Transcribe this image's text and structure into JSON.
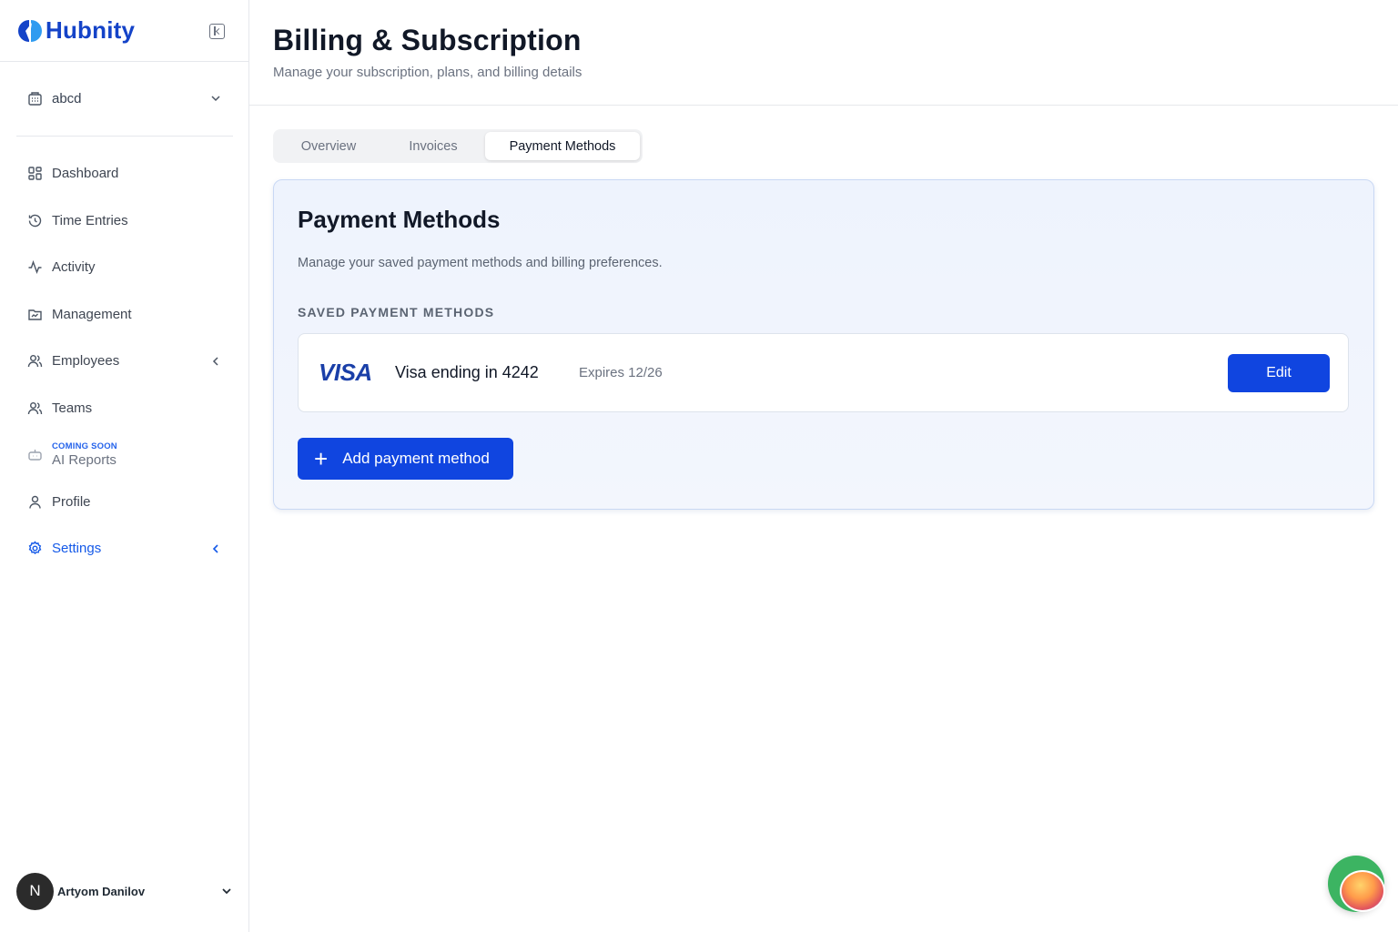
{
  "app": {
    "name": "Hubnity"
  },
  "workspace": {
    "name": "abcd"
  },
  "nav": [
    {
      "label": "Dashboard",
      "icon": "dashboard-icon"
    },
    {
      "label": "Time Entries",
      "icon": "history-icon"
    },
    {
      "label": "Activity",
      "icon": "activity-icon"
    },
    {
      "label": "Management",
      "icon": "folder-icon"
    },
    {
      "label": "Employees",
      "icon": "users-icon"
    },
    {
      "label": "Teams",
      "icon": "users-icon"
    },
    {
      "label": "AI Reports",
      "badge": "COMING SOON",
      "icon": "bot-icon"
    },
    {
      "label": "Profile",
      "icon": "user-icon"
    },
    {
      "label": "Settings",
      "icon": "gear-icon",
      "active": true
    }
  ],
  "user": {
    "initial": "N",
    "name": "Artyom Danilov"
  },
  "page": {
    "title": "Billing & Subscription",
    "subtitle": "Manage your subscription, plans, and billing details"
  },
  "tabs": [
    {
      "label": "Overview"
    },
    {
      "label": "Invoices"
    },
    {
      "label": "Payment Methods",
      "active": true
    }
  ],
  "payment": {
    "title": "Payment Methods",
    "description": "Manage your saved payment methods and billing preferences.",
    "section_label": "SAVED PAYMENT METHODS",
    "methods": [
      {
        "brand": "VISA",
        "name": "Visa ending in 4242",
        "expires": "Expires 12/26",
        "edit_label": "Edit"
      }
    ],
    "add_label": "Add payment method"
  },
  "colors": {
    "accent": "#1045e0",
    "active_nav": "#1459e8",
    "brand": "#1443c8"
  }
}
